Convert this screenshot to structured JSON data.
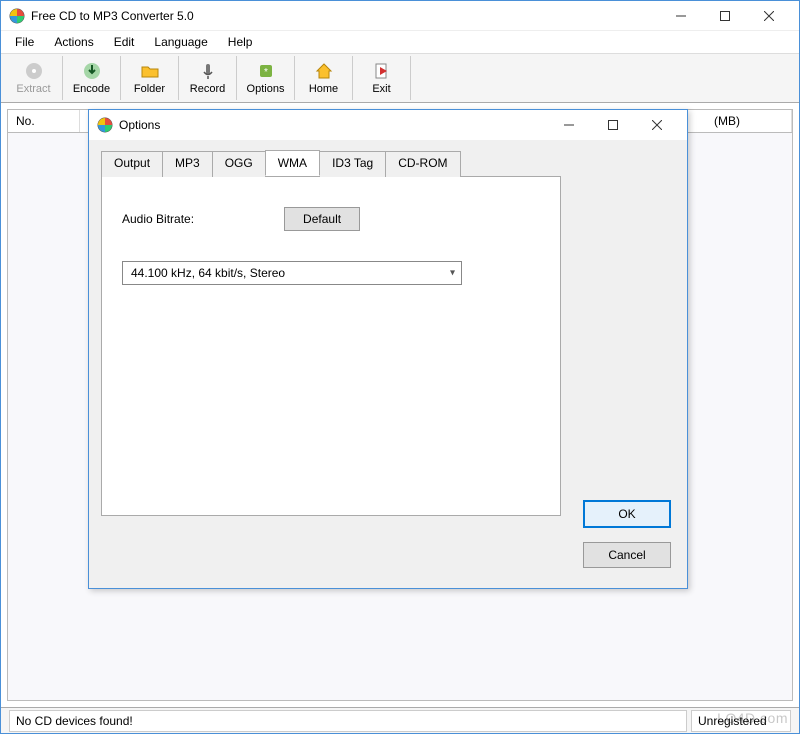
{
  "main": {
    "title": "Free CD to MP3 Converter 5.0",
    "menubar": [
      "File",
      "Actions",
      "Edit",
      "Language",
      "Help"
    ],
    "toolbar": [
      {
        "name": "extract",
        "label": "Extract",
        "disabled": true
      },
      {
        "name": "encode",
        "label": "Encode",
        "disabled": false
      },
      {
        "name": "folder",
        "label": "Folder",
        "disabled": false
      },
      {
        "name": "record",
        "label": "Record",
        "disabled": false
      },
      {
        "name": "options",
        "label": "Options",
        "disabled": false
      },
      {
        "name": "home",
        "label": "Home",
        "disabled": false
      },
      {
        "name": "exit",
        "label": "Exit",
        "disabled": false
      }
    ],
    "table": {
      "columns": {
        "no": "No.",
        "mb": "(MB)"
      }
    },
    "status": {
      "left": "No CD devices found!",
      "right": "Unregistered"
    }
  },
  "dialog": {
    "title": "Options",
    "tabs": [
      "Output",
      "MP3",
      "OGG",
      "WMA",
      "ID3 Tag",
      "CD-ROM"
    ],
    "active_tab": "WMA",
    "wma": {
      "bitrate_label": "Audio Bitrate:",
      "default_button": "Default",
      "dropdown_value": "44.100 kHz,  64 kbit/s, Stereo"
    },
    "buttons": {
      "ok": "OK",
      "cancel": "Cancel"
    }
  },
  "watermark": "LO4D.com"
}
